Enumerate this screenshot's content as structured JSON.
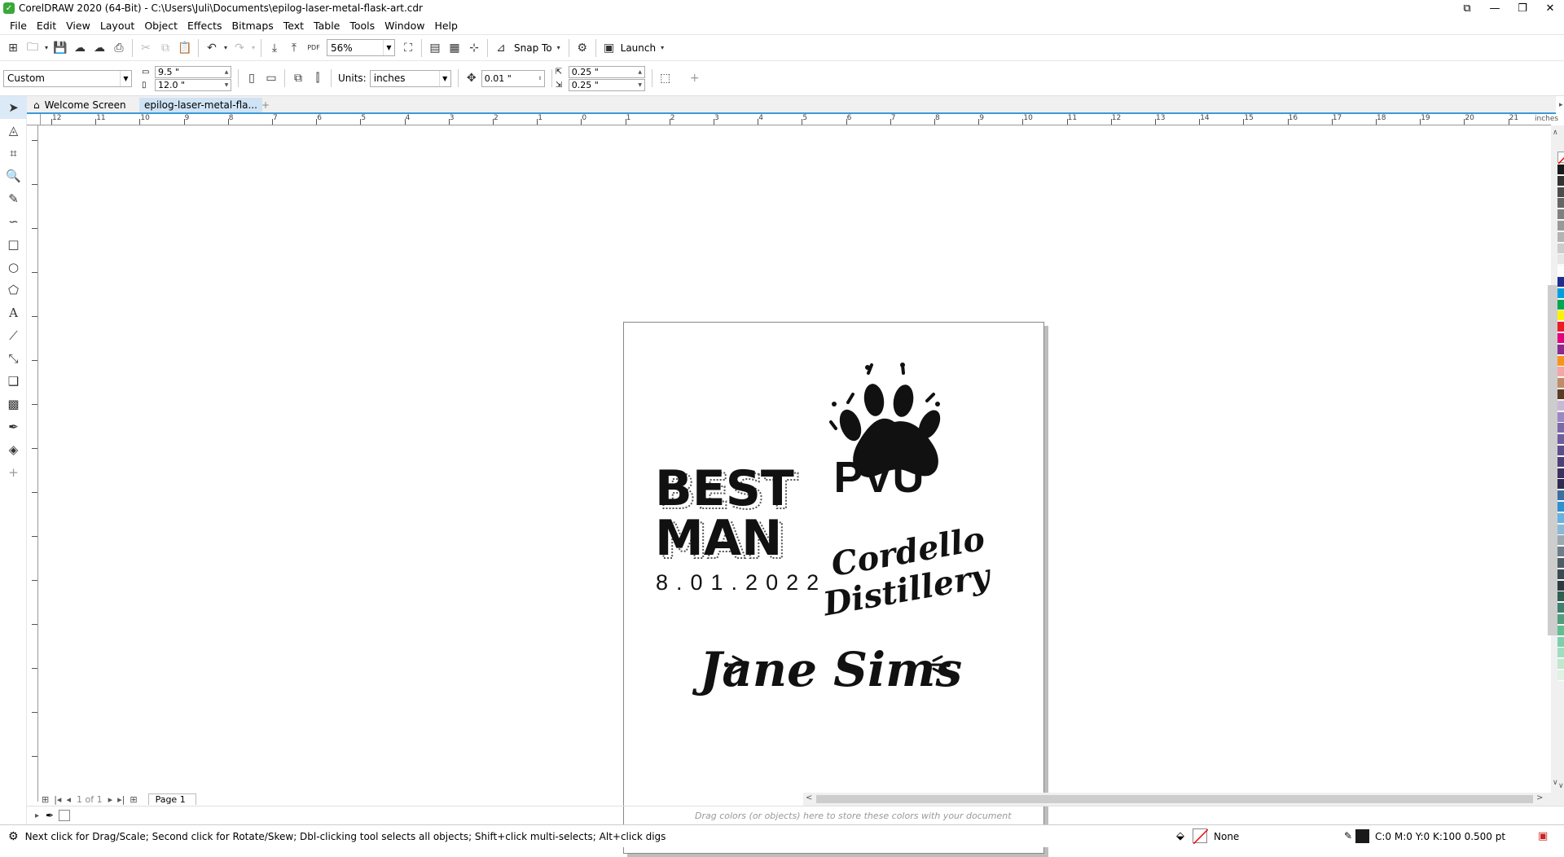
{
  "window": {
    "title": "CorelDRAW 2020 (64-Bit) - C:\\Users\\Juli\\Documents\\epilog-laser-metal-flask-art.cdr"
  },
  "menu": [
    "File",
    "Edit",
    "View",
    "Layout",
    "Object",
    "Effects",
    "Bitmaps",
    "Text",
    "Table",
    "Tools",
    "Window",
    "Help"
  ],
  "toolbar": {
    "zoom": "56%",
    "snap_to": "Snap To",
    "launch": "Launch"
  },
  "properties": {
    "page_preset": "Custom",
    "width": "9.5 \"",
    "height": "12.0 \"",
    "units_label": "Units:",
    "units": "inches",
    "nudge": "0.01 \"",
    "dup_x": "0.25 \"",
    "dup_y": "0.25 \""
  },
  "tabs": {
    "welcome": "Welcome Screen",
    "document": "epilog-laser-metal-fla..."
  },
  "ruler": {
    "unit": "inches",
    "h_ticks": [
      "12",
      "11",
      "10",
      "9",
      "8",
      "7",
      "6",
      "5",
      "4",
      "3",
      "2",
      "1",
      "0",
      "1",
      "2",
      "3",
      "4",
      "5",
      "6",
      "7",
      "8",
      "9",
      "10",
      "11",
      "12",
      "13",
      "14",
      "15",
      "16",
      "17",
      "18",
      "19",
      "20",
      "21"
    ]
  },
  "artwork": {
    "best_line1": "BEST",
    "best_line2": "MAN",
    "date": "8.01.2022",
    "pvu": "PVU",
    "cordello_line1": "Cordello",
    "cordello_line2": "Distillery",
    "jane": "Jane Sims"
  },
  "page_nav": {
    "counter": "1 of 1",
    "page_tab": "Page 1"
  },
  "docker_hint": "Drag colors (or objects) here to store these colors with your document",
  "status": {
    "hint": "Next click for Drag/Scale; Second click for Rotate/Skew; Dbl-clicking tool selects all objects; Shift+click multi-selects; Alt+click digs",
    "fill": "None",
    "outline": "C:0 M:0 Y:0 K:100  0.500 pt"
  },
  "palette_colors": [
    "#1a1a1a",
    "#333333",
    "#4d4d4d",
    "#666666",
    "#808080",
    "#999999",
    "#b3b3b3",
    "#cccccc",
    "#e6e6e6",
    "#ffffff",
    "#1f2d8f",
    "#00a0e0",
    "#00a651",
    "#fff200",
    "#ed1c24",
    "#e4007c",
    "#8b2a8f",
    "#f7941d",
    "#f4a6a6",
    "#c08b6b",
    "#5c3b24",
    "#c8b8d8",
    "#9c88c4",
    "#7b6aa8",
    "#6f5e9e",
    "#5e4f8c",
    "#4b4078",
    "#3b3260",
    "#2e2a50",
    "#3d6f9e",
    "#2f8fd0",
    "#66b2e0",
    "#8cb8d6",
    "#9aa8b0",
    "#6e7e88",
    "#4e5e68",
    "#3a4a52",
    "#2a3a40",
    "#2f5f4f",
    "#3f7f6f",
    "#4f9f7f",
    "#5fbf8f",
    "#7fcfaf",
    "#9fdfbf",
    "#bfe8cf",
    "#dff2e4"
  ]
}
